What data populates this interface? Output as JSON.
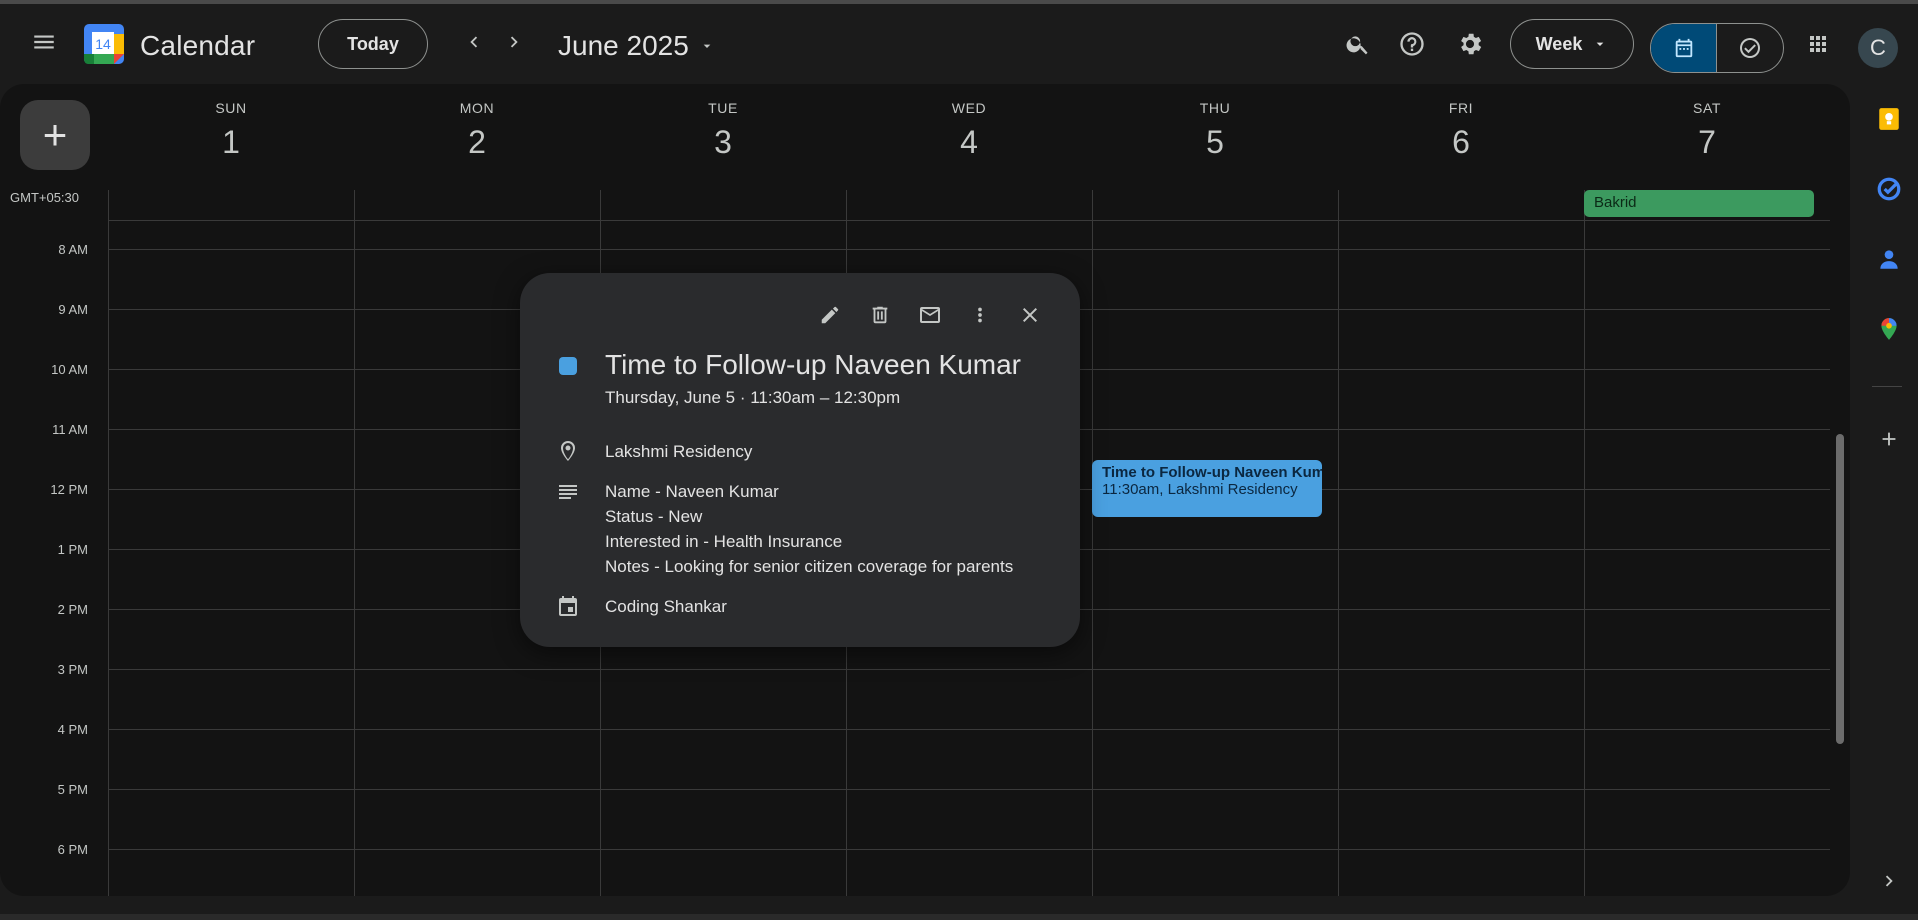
{
  "header": {
    "app_title": "Calendar",
    "logo_number": "14",
    "today_label": "Today",
    "month_label": "June 2025",
    "view_label": "Week",
    "avatar_letter": "C"
  },
  "timezone": "GMT+05:30",
  "days": [
    {
      "name": "SUN",
      "date": "1"
    },
    {
      "name": "MON",
      "date": "2"
    },
    {
      "name": "TUE",
      "date": "3"
    },
    {
      "name": "WED",
      "date": "4"
    },
    {
      "name": "THU",
      "date": "5"
    },
    {
      "name": "FRI",
      "date": "6"
    },
    {
      "name": "SAT",
      "date": "7"
    }
  ],
  "hours": [
    "8 AM",
    "9 AM",
    "10 AM",
    "11 AM",
    "12 PM",
    "1 PM",
    "2 PM",
    "3 PM",
    "4 PM",
    "5 PM",
    "6 PM"
  ],
  "all_day_event": {
    "title": "Bakrid",
    "color": "#3c9a5f"
  },
  "event": {
    "title": "Time to Follow-up Naveen Kumar",
    "subtitle": "11:30am, Lakshmi Residency",
    "color": "#4aa0e0"
  },
  "popup": {
    "title": "Time to Follow-up Naveen Kumar",
    "time": "Thursday, June 5  ·  11:30am – 12:30pm",
    "location": "Lakshmi Residency",
    "description": [
      "Name -  Naveen Kumar",
      "Status - New",
      "Interested in - Health Insurance",
      "Notes - Looking for senior citizen coverage for parents"
    ],
    "calendar": "Coding Shankar"
  },
  "colors": {
    "accent": "#004a77",
    "background": "#131313",
    "event_blue": "#4aa0e0",
    "holiday_green": "#3c9a5f"
  }
}
